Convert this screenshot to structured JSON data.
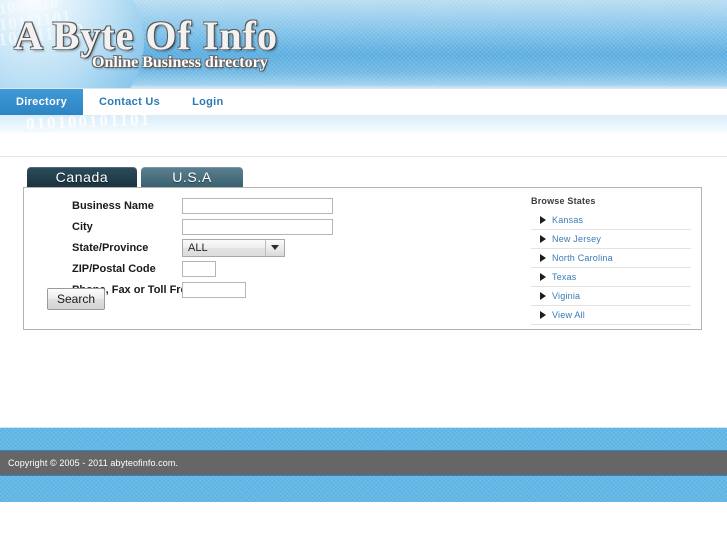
{
  "site": {
    "logo_title": "A Byte Of Info",
    "logo_subtitle": "Online Business directory",
    "globe_bits": [
      "010101",
      "0100110",
      "101001110",
      "01010111101",
      "010101111010"
    ],
    "watermark_bits": "010100101101"
  },
  "nav": {
    "items": [
      {
        "label": "Directory",
        "active": true
      },
      {
        "label": "Contact Us",
        "active": false
      },
      {
        "label": "Login",
        "active": false
      }
    ]
  },
  "tabs": [
    {
      "label": "Canada",
      "active": true
    },
    {
      "label": "U.S.A",
      "active": false
    }
  ],
  "search_form": {
    "fields": [
      {
        "label": "Business Name",
        "value": "",
        "placeholder": "",
        "type": "text",
        "size": "wide"
      },
      {
        "label": "City",
        "value": "",
        "placeholder": "",
        "type": "text",
        "size": "wide"
      },
      {
        "label": "State/Province",
        "value": "ALL",
        "type": "select",
        "size": "select"
      },
      {
        "label": "ZIP/Postal Code",
        "value": "",
        "placeholder": "",
        "type": "text",
        "size": "small"
      },
      {
        "label": "Phone, Fax or Toll Free",
        "value": "",
        "placeholder": "",
        "type": "text",
        "size": "mid"
      }
    ],
    "state_options": [
      "ALL"
    ],
    "submit_label": "Search"
  },
  "browse": {
    "title": "Browse States",
    "items": [
      {
        "label": "Kansas"
      },
      {
        "label": "New Jersey"
      },
      {
        "label": "North Carolina"
      },
      {
        "label": "Texas"
      },
      {
        "label": "Viginia"
      },
      {
        "label": "View All"
      }
    ]
  },
  "footer": {
    "copyright": "Copyright © 2005 - 2011 abyteofinfo.com."
  },
  "colors": {
    "header_blue": "#59ace0",
    "nav_active": "#2d84c4",
    "link_blue": "#3b7bb5",
    "tab_active": "#1b3340",
    "tab_inactive": "#39616f",
    "footer_gray": "#666666",
    "band_blue": "#5cb3e4"
  }
}
